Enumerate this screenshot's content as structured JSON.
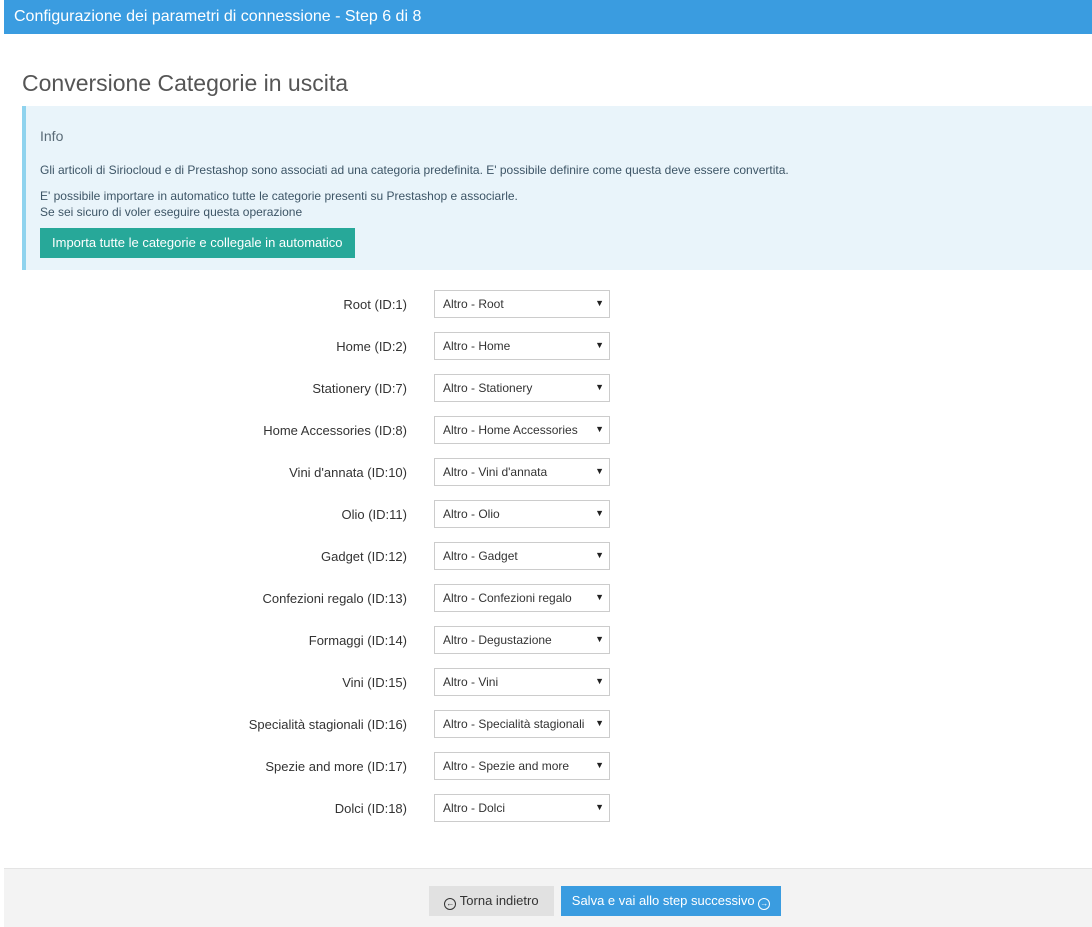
{
  "header": {
    "title": "Configurazione dei parametri di connessione - Step 6 di 8"
  },
  "page": {
    "title": "Conversione Categorie in uscita"
  },
  "info": {
    "title": "Info",
    "line1": "Gli articoli di Siriocloud e di Prestashop sono associati ad una categoria predefinita. E' possibile definire come questa deve essere convertita.",
    "line2": "E' possibile importare in automatico tutte le categorie presenti su Prestashop e associarle.",
    "line3": "Se sei sicuro di voler eseguire questa operazione",
    "import_button": "Importa tutte le categorie e collegale in automatico"
  },
  "mappings": [
    {
      "label": "Root (ID:1)",
      "value": "Altro - Root"
    },
    {
      "label": "Home (ID:2)",
      "value": "Altro - Home"
    },
    {
      "label": "Stationery (ID:7)",
      "value": "Altro - Stationery"
    },
    {
      "label": "Home Accessories (ID:8)",
      "value": "Altro - Home Accessories"
    },
    {
      "label": "Vini d'annata (ID:10)",
      "value": "Altro - Vini d'annata"
    },
    {
      "label": "Olio (ID:11)",
      "value": "Altro - Olio"
    },
    {
      "label": "Gadget (ID:12)",
      "value": "Altro - Gadget"
    },
    {
      "label": "Confezioni regalo (ID:13)",
      "value": "Altro - Confezioni regalo"
    },
    {
      "label": "Formaggi (ID:14)",
      "value": "Altro - Degustazione"
    },
    {
      "label": "Vini (ID:15)",
      "value": "Altro - Vini"
    },
    {
      "label": "Specialità stagionali (ID:16)",
      "value": "Altro - Specialità stagionali"
    },
    {
      "label": "Spezie and more (ID:17)",
      "value": "Altro - Spezie and more"
    },
    {
      "label": "Dolci (ID:18)",
      "value": "Altro - Dolci"
    }
  ],
  "footer": {
    "back_label": "Torna indietro",
    "next_label": "Salva e vai allo step successivo",
    "back_icon": "arrow-circle-left-icon",
    "next_icon": "arrow-circle-right-icon"
  },
  "colors": {
    "header_bg": "#3a9ce0",
    "info_bg": "#e9f4fa",
    "info_border": "#8fd3ee",
    "import_button": "#27a899",
    "next_button": "#3a9ce0",
    "back_button": "#e1e1e1"
  }
}
